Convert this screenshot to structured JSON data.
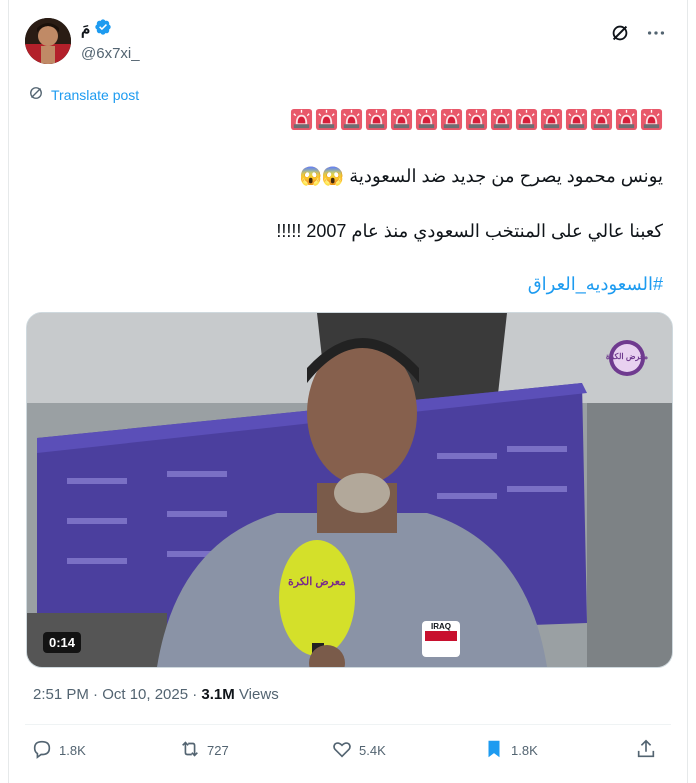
{
  "author": {
    "display_name": "مَ",
    "handle": "@6x7xi_",
    "verified": true
  },
  "translate_label": "Translate post",
  "post": {
    "alarm_emoji_count": 15,
    "line1": "يونس محمود يصرح من جديد ضد السعودية 😱😱",
    "line2": "كعبنا عالي على المنتخب السعودي منذ عام 2007 !!!!!",
    "hashtag": "#السعوديه_العراق"
  },
  "video": {
    "duration": "0:14",
    "mic_label": "معرض الكرة",
    "badge": "IRAQ",
    "logo_text": "معرض الكرة"
  },
  "meta": {
    "time_date": "2:51 PM · Oct 10, 2025 · ",
    "views_count": "3.1M",
    "views_label": " Views"
  },
  "actions": {
    "replies": "1.8K",
    "reposts": "727",
    "likes": "5.4K",
    "bookmarks": "1.8K"
  },
  "colors": {
    "link": "#1d9bf0",
    "text": "#0f1419",
    "secondary": "#536471",
    "verified": "#1d9bf0"
  }
}
